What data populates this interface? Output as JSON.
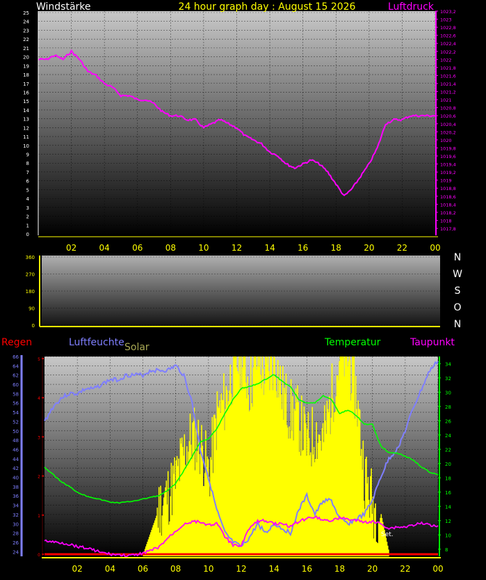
{
  "top": {
    "title": "24 hour graph day : August 15 2026",
    "left_label": "Windstärke",
    "right_label": "Luftdruck",
    "colors": {
      "pressure": "#ff00ff",
      "left_axis": "#ffffff",
      "right_axis": "#ff00ff",
      "title": "#ffff00"
    }
  },
  "middle": {
    "compass": [
      "N",
      "W",
      "S",
      "O",
      "N"
    ],
    "colors": {
      "axis": "#ffff00",
      "compass": "#ffffff"
    }
  },
  "bottom": {
    "labels": {
      "rain": "Regen",
      "humidity": "Luftfeuchte",
      "solar": "Solar",
      "temperature": "Temperatur",
      "dewpoint": "Taupunkt"
    },
    "annotation": "Set.",
    "colors": {
      "rain": "#ff0000",
      "humidity": "#7f7fff",
      "solar": "#ffff00",
      "temperature": "#00ff00",
      "dewpoint": "#ff00ff"
    }
  },
  "x_ticks": [
    "02",
    "04",
    "06",
    "08",
    "10",
    "12",
    "14",
    "16",
    "18",
    "20",
    "22",
    "00"
  ],
  "chart_data": [
    {
      "type": "line",
      "name": "wind-pressure",
      "x_hours": [
        0.0,
        0.5,
        1.0,
        1.5,
        2.0,
        2.5,
        3.0,
        3.5,
        4.0,
        4.5,
        5.0,
        5.5,
        6.0,
        6.5,
        7.0,
        7.5,
        8.0,
        8.5,
        9.0,
        9.5,
        10.0,
        10.5,
        11.0,
        11.5,
        12.0,
        12.5,
        13.0,
        13.5,
        14.0,
        14.5,
        15.0,
        15.5,
        16.0,
        16.5,
        17.0,
        17.5,
        18.0,
        18.5,
        19.0,
        19.5,
        20.0,
        20.5,
        21.0,
        21.5,
        22.0,
        22.5,
        23.0,
        23.5,
        24.0
      ],
      "series": [
        {
          "name": "Luftdruck",
          "axis": "right",
          "values": [
            1022.0,
            1022.0,
            1022.1,
            1022.0,
            1022.2,
            1022.0,
            1021.7,
            1021.6,
            1021.4,
            1021.3,
            1021.1,
            1021.1,
            1021.0,
            1021.0,
            1020.9,
            1020.7,
            1020.6,
            1020.6,
            1020.5,
            1020.5,
            1020.3,
            1020.4,
            1020.5,
            1020.4,
            1020.3,
            1020.1,
            1020.0,
            1019.9,
            1019.7,
            1019.6,
            1019.4,
            1019.3,
            1019.4,
            1019.5,
            1019.4,
            1019.2,
            1018.9,
            1018.6,
            1018.8,
            1019.1,
            1019.4,
            1019.8,
            1020.4,
            1020.5,
            1020.5,
            1020.6,
            1020.6,
            1020.6,
            1020.6
          ]
        }
      ],
      "left_axis": {
        "label": "Windstärke",
        "ticks": [
          0,
          1,
          2,
          3,
          4,
          5,
          6,
          7,
          8,
          9,
          10,
          11,
          12,
          13,
          14,
          15,
          16,
          17,
          18,
          19,
          20,
          21,
          22,
          23,
          24,
          25
        ]
      },
      "right_axis": {
        "label": "Luftdruck",
        "ticks": [
          "1017,8",
          "1018",
          "1018,2",
          "1018,4",
          "1018,6",
          "1018,8",
          "1019",
          "1019,2",
          "1019,4",
          "1019,6",
          "1019,8",
          "1020",
          "1020,2",
          "1020,4",
          "1020,6",
          "1020,8",
          "1021",
          "1021,2",
          "1021,4",
          "1021,6",
          "1021,8",
          "1022",
          "1022,2",
          "1022,4",
          "1022,6",
          "1022,8",
          "1023",
          "1023,2"
        ],
        "ylim": [
          1017.8,
          1023.2
        ]
      },
      "grid": true
    },
    {
      "type": "line",
      "name": "wind-direction",
      "y_ticks": [
        0,
        90,
        180,
        270,
        360
      ],
      "ylim": [
        0,
        360
      ],
      "series": []
    },
    {
      "type": "line",
      "name": "sensors",
      "x_hours": [
        0.0,
        0.5,
        1.0,
        1.5,
        2.0,
        2.5,
        3.0,
        3.5,
        4.0,
        4.5,
        5.0,
        5.5,
        6.0,
        6.5,
        7.0,
        7.5,
        8.0,
        8.5,
        9.0,
        9.5,
        10.0,
        10.5,
        11.0,
        11.5,
        12.0,
        12.5,
        13.0,
        13.5,
        14.0,
        14.5,
        15.0,
        15.5,
        16.0,
        16.5,
        17.0,
        17.5,
        18.0,
        18.5,
        19.0,
        19.5,
        20.0,
        20.5,
        21.0,
        21.5,
        22.0,
        22.5,
        23.0,
        23.5,
        24.0
      ],
      "series": [
        {
          "name": "Luftfeuchte",
          "axis": "left",
          "values": [
            52,
            55,
            57,
            58,
            58,
            59,
            59,
            60,
            61,
            61,
            62,
            62,
            62,
            63,
            63,
            63,
            64,
            62,
            56,
            46,
            40,
            33,
            28,
            26,
            25,
            27,
            30,
            28,
            30,
            29,
            28,
            33,
            36,
            32,
            35,
            35,
            31,
            30,
            31,
            32,
            35,
            40,
            44,
            46,
            50,
            55,
            59,
            63,
            65
          ]
        },
        {
          "name": "Temperatur",
          "axis": "right",
          "values": [
            19.5,
            18.5,
            17.5,
            16.8,
            16.0,
            15.5,
            15.2,
            14.9,
            14.6,
            14.5,
            14.6,
            14.8,
            15.0,
            15.3,
            15.5,
            16.2,
            17.2,
            19.0,
            21.0,
            23.0,
            23.5,
            24.8,
            27.0,
            29.0,
            30.5,
            30.8,
            31.2,
            31.8,
            32.5,
            31.5,
            30.8,
            29.0,
            28.5,
            28.5,
            29.5,
            29.0,
            27.0,
            27.5,
            26.8,
            25.5,
            25.5,
            22.5,
            21.5,
            21.5,
            21.0,
            20.5,
            19.5,
            18.8,
            18.4
          ]
        },
        {
          "name": "Taupunkt",
          "axis": "right",
          "values": [
            9.2,
            9.0,
            8.9,
            8.7,
            8.4,
            8.2,
            7.9,
            7.5,
            7.3,
            7.2,
            7.1,
            7.1,
            7.5,
            7.8,
            8.3,
            9.5,
            10.5,
            11.5,
            11.9,
            11.8,
            11.4,
            11.6,
            9.8,
            8.5,
            8.6,
            11.0,
            11.9,
            12.0,
            11.6,
            11.5,
            11.2,
            11.9,
            12.3,
            12.6,
            12.1,
            12.0,
            12.4,
            12.2,
            12.0,
            11.8,
            11.8,
            11.6,
            10.9,
            11.1,
            11.1,
            11.4,
            11.6,
            11.4,
            11.3
          ]
        },
        {
          "name": "Solar",
          "axis": "none",
          "values": [
            0,
            0,
            0,
            0,
            0,
            0,
            0,
            0,
            0,
            0,
            0,
            0,
            0,
            0.12,
            0.24,
            0.3,
            0.38,
            0.52,
            0.6,
            0.55,
            0.4,
            0.7,
            0.78,
            0.95,
            1.0,
            0.85,
            1.0,
            0.88,
            1.0,
            0.8,
            0.72,
            0.68,
            0.55,
            0.62,
            0.58,
            0.8,
            1.0,
            1.0,
            0.8,
            0.4,
            0.25,
            0.2,
            0,
            0,
            0,
            0,
            0,
            0,
            0
          ]
        },
        {
          "name": "Regen",
          "axis": "rain",
          "values": [
            0,
            0,
            0,
            0,
            0,
            0,
            0,
            0,
            0,
            0,
            0,
            0,
            0,
            0,
            0,
            0,
            0,
            0,
            0,
            0,
            0,
            0,
            0,
            0,
            0,
            0,
            0,
            0,
            0,
            0,
            0,
            0,
            0,
            0,
            0,
            0,
            0,
            0,
            0,
            0,
            0,
            0,
            0,
            0,
            0,
            0,
            0,
            0,
            0
          ]
        }
      ],
      "left_axis": {
        "label": "Luftfeuchte",
        "ticks": [
          24,
          26,
          28,
          30,
          32,
          34,
          36,
          38,
          40,
          42,
          44,
          46,
          48,
          50,
          52,
          54,
          56,
          58,
          60,
          62,
          64,
          66
        ],
        "ylim": [
          23,
          66
        ]
      },
      "right_axis": {
        "label": "Temperatur",
        "ticks": [
          8,
          10,
          12,
          14,
          16,
          18,
          20,
          22,
          24,
          26,
          28,
          30,
          32,
          34
        ],
        "ylim": [
          7,
          35
        ]
      },
      "rain_axis": {
        "ticks": [
          0,
          1,
          2,
          3,
          4,
          5
        ]
      },
      "annotations": [
        "Set."
      ],
      "grid": true
    }
  ]
}
